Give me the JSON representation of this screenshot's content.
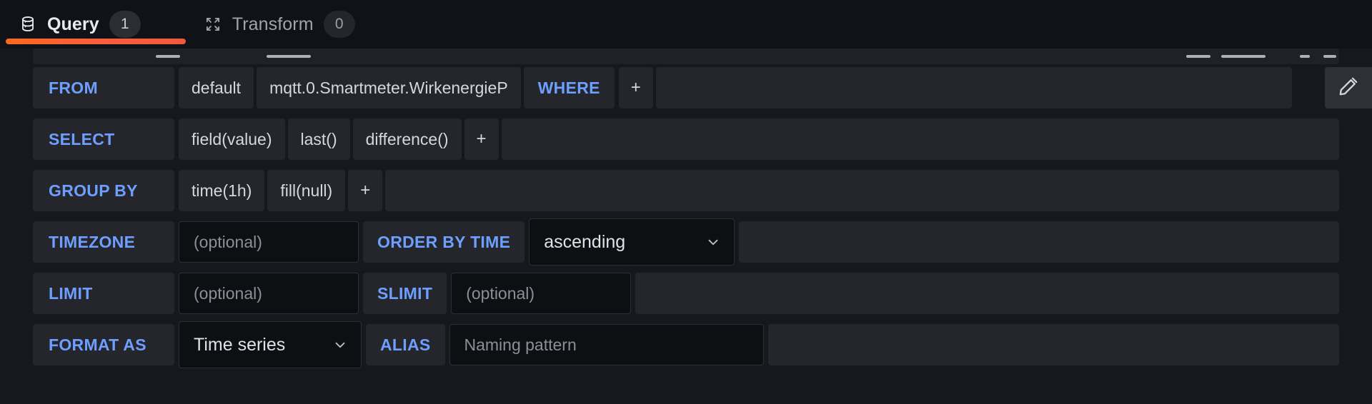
{
  "tabs": [
    {
      "label": "Query",
      "badge": "1",
      "icon": "database-icon",
      "active": true
    },
    {
      "label": "Transform",
      "badge": "0",
      "icon": "transform-icon",
      "active": false
    }
  ],
  "accent": "#6e9fff",
  "underline_color": "#f96a20",
  "query_editor": {
    "rows": {
      "from": {
        "key": "FROM",
        "policy": "default",
        "measurement": "mqtt.0.Smartmeter.WirkenergieP",
        "where_key": "WHERE",
        "add": "+"
      },
      "select": {
        "key": "SELECT",
        "parts": [
          "field(value)",
          "last()",
          "difference()"
        ],
        "add": "+"
      },
      "group_by": {
        "key": "GROUP BY",
        "parts": [
          "time(1h)",
          "fill(null)"
        ],
        "add": "+"
      },
      "timezone": {
        "key": "TIMEZONE",
        "value": "",
        "placeholder": "(optional)",
        "order_key": "ORDER BY TIME",
        "order_value": "ascending"
      },
      "limit": {
        "key": "LIMIT",
        "value": "",
        "placeholder": "(optional)",
        "slimit_key": "SLIMIT",
        "slimit_value": "",
        "slimit_placeholder": "(optional)"
      },
      "format": {
        "key": "FORMAT AS",
        "value": "Time series",
        "alias_key": "ALIAS",
        "alias_value": "",
        "alias_placeholder": "Naming pattern"
      }
    },
    "edit_button": "edit-icon"
  }
}
